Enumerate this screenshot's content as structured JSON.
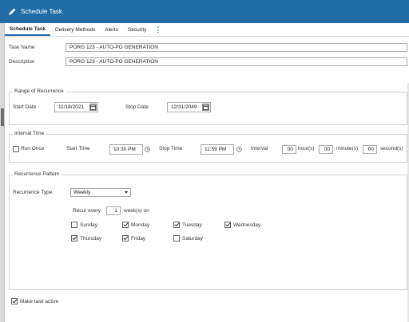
{
  "window": {
    "title": "Schedule Task"
  },
  "tabs": [
    "Schedule Task",
    "Delivery Methods",
    "Alerts",
    "Security"
  ],
  "more_label": "⋮",
  "task": {
    "name_label": "Task Name",
    "name_value": "PORG 123 - AUTO-PO GENERATION",
    "description_label": "Description",
    "description_value": "PORG 123 - AUTO-PO GENERATION"
  },
  "range": {
    "legend": "Range of Recurrence",
    "start_label": "Start Date",
    "start_value": "11/18/2021",
    "stop_label": "Stop Date",
    "stop_value": "12/31/2049"
  },
  "interval": {
    "legend": "Interval Time",
    "run_once_label": "Run Once",
    "run_once_checked": false,
    "start_time_label": "Start Time",
    "start_time_value": "10:30 PM",
    "stop_time_label": "Stop Time",
    "stop_time_value": "11:59 PM",
    "interval_label": "Interval",
    "hours_value": "00",
    "hours_label": "hour(s)",
    "minutes_value": "00",
    "minutes_label": "minute(s)",
    "seconds_value": "00",
    "seconds_label": "second(s)"
  },
  "pattern": {
    "legend": "Recurrence Pattern",
    "type_label": "Recurrence Type",
    "type_value": "Weekly",
    "recur_every_label": "Recur every",
    "recur_every_value": "1",
    "weeks_on_label": "week(s) on",
    "days": {
      "sunday": {
        "label": "Sunday",
        "checked": false
      },
      "monday": {
        "label": "Monday",
        "checked": true
      },
      "tuesday": {
        "label": "Tuesday",
        "checked": true
      },
      "wednesday": {
        "label": "Wednesday",
        "checked": true
      },
      "thursday": {
        "label": "Thursday",
        "checked": true
      },
      "friday": {
        "label": "Friday",
        "checked": true
      },
      "saturday": {
        "label": "Saturday",
        "checked": false
      }
    }
  },
  "footer": {
    "make_active_label": "Make task active",
    "make_active_checked": true
  },
  "colors": {
    "titlebar": "#1f6ca6",
    "accent": "#1f6ca6"
  }
}
